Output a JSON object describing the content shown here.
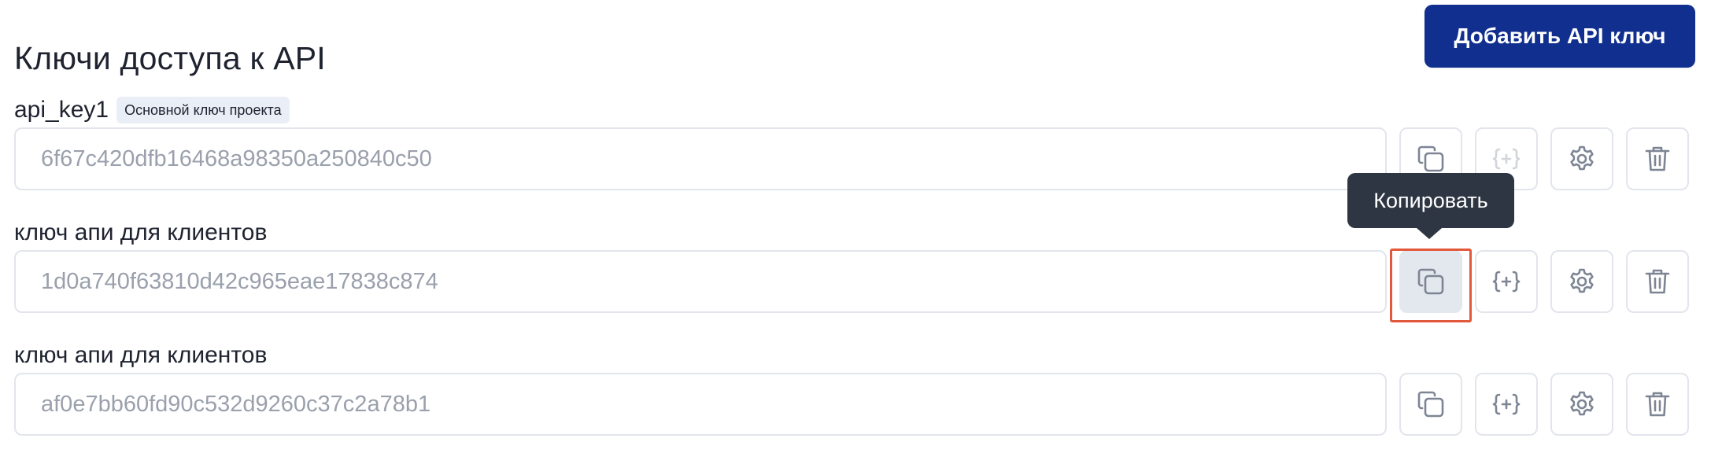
{
  "page": {
    "title": "Ключи доступа к API",
    "add_button_label": "Добавить API ключ"
  },
  "tooltip": {
    "text": "Копировать"
  },
  "icons": {
    "copy": "copy-icon",
    "variables": "curly-braces-plus-icon",
    "settings": "gear-icon",
    "delete": "trash-icon"
  },
  "colors": {
    "primary_button": "#102f8f",
    "highlight": "#e2583a",
    "tooltip_bg": "#2f3643",
    "icon": "#7d8594",
    "input_text": "#9aa0ac"
  },
  "keys": [
    {
      "name": "api_key1",
      "badge": "Основной ключ проекта",
      "value": "6f67c420dfb16468a98350a250840c50",
      "variables_enabled": false
    },
    {
      "name": "ключ апи для клиентов",
      "badge": "",
      "value": "1d0a740f63810d42c965eae17838c874",
      "variables_enabled": true
    },
    {
      "name": "ключ апи для клиентов",
      "badge": "",
      "value": "af0e7bb60fd90c532d9260c37c2a78b1",
      "variables_enabled": true
    }
  ]
}
